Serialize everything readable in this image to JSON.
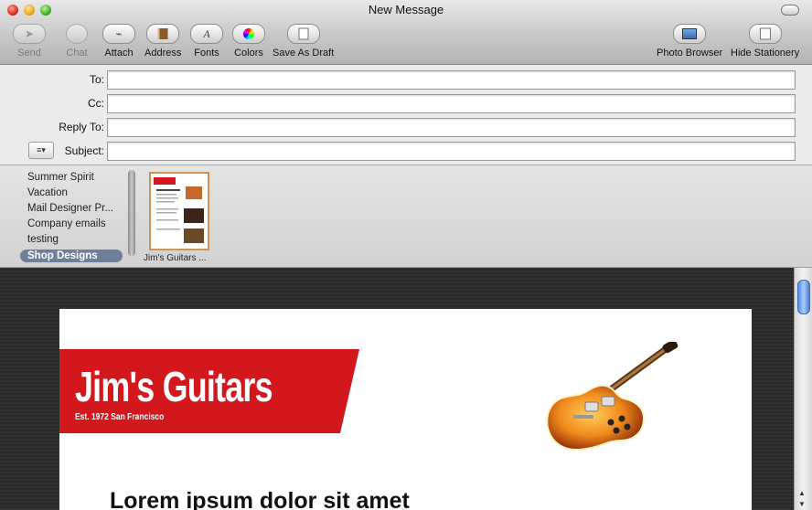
{
  "window": {
    "title": "New Message"
  },
  "toolbar": {
    "left": [
      {
        "label": "Send",
        "icon": "paper-plane",
        "enabled": false
      },
      {
        "label": "Chat",
        "icon": "chat-bubble",
        "enabled": false
      },
      {
        "label": "Attach",
        "icon": "paperclip",
        "enabled": true
      },
      {
        "label": "Address",
        "icon": "address-book",
        "enabled": true
      },
      {
        "label": "Fonts",
        "icon": "letter-a",
        "enabled": true
      },
      {
        "label": "Colors",
        "icon": "color-wheel",
        "enabled": true
      },
      {
        "label": "Save As Draft",
        "icon": "document",
        "enabled": true
      }
    ],
    "right": [
      {
        "label": "Photo Browser",
        "icon": "photo"
      },
      {
        "label": "Hide Stationery",
        "icon": "stationery"
      }
    ]
  },
  "headers": {
    "to": {
      "label": "To:",
      "value": ""
    },
    "cc": {
      "label": "Cc:",
      "value": ""
    },
    "reply_to": {
      "label": "Reply To:",
      "value": ""
    },
    "subject": {
      "label": "Subject:",
      "value": ""
    },
    "accounts_menu": "≡▾"
  },
  "stationery": {
    "categories": [
      {
        "label": "Summer Spirit",
        "selected": false
      },
      {
        "label": "Vacation",
        "selected": false
      },
      {
        "label": "Mail Designer Pr...",
        "selected": false
      },
      {
        "label": "Company emails",
        "selected": false
      },
      {
        "label": "testing",
        "selected": false
      },
      {
        "label": "Shop Designs",
        "selected": true
      }
    ],
    "templates": [
      {
        "name": "Jim's Guitars ..."
      }
    ]
  },
  "message": {
    "store_name": "Jim's Guitars",
    "tagline": "Est. 1972 San Francisco",
    "headline": "Lorem ipsum dolor sit amet",
    "accent_color": "#d3181d"
  }
}
